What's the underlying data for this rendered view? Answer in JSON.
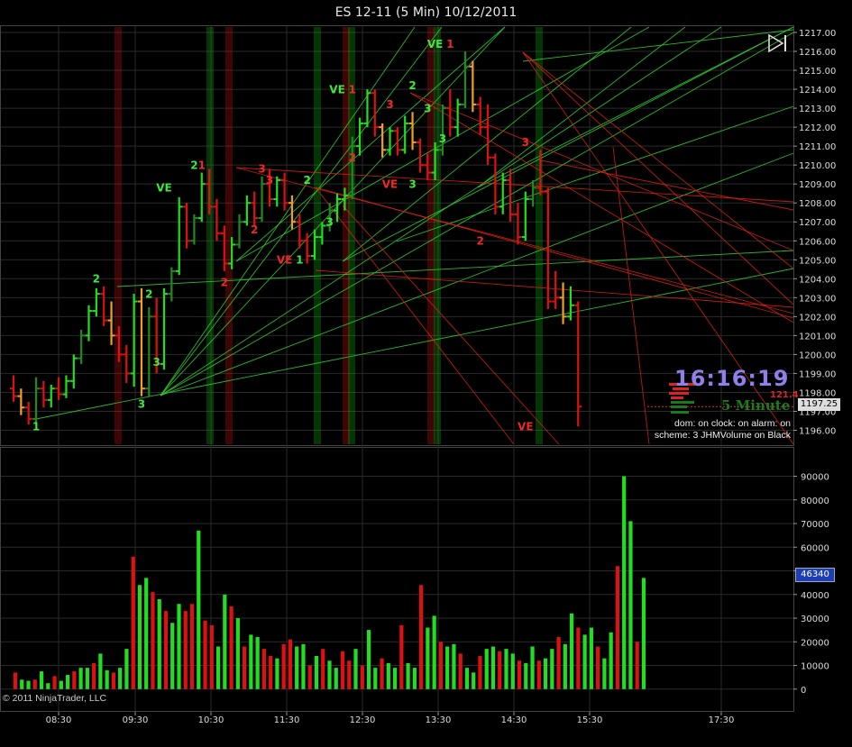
{
  "window": {
    "title": "ES 12-11 (5 Min)  10/12/2011"
  },
  "overlay": {
    "clock": "16:16:19",
    "timeframe": "5 Minute",
    "status_line": "dom: on clock: on alarm: on",
    "scheme_line": "scheme: 3 JHMVolume on Black",
    "small_value": "121.4"
  },
  "footer": {
    "copyright": "© 2011 NinjaTrader, LLC"
  },
  "colors": {
    "up": "#22dd22",
    "down": "#dd1111",
    "grid": "#2a2a2a",
    "dark_up": "#1f8a1f",
    "orange": "#f0a020"
  },
  "icons": {
    "play": "play-end-icon"
  },
  "chart_data": [
    {
      "type": "bar",
      "name": "price",
      "title": "ES 12-11 (5 Min) 10/12/2011",
      "ylim": [
        1195.5,
        1217
      ],
      "y_ticks": [
        "1196.00",
        "1197.00",
        "1198.00",
        "1199.00",
        "1200.00",
        "1201.00",
        "1202.00",
        "1203.00",
        "1204.00",
        "1205.00",
        "1206.00",
        "1207.00",
        "1208.00",
        "1209.00",
        "1210.00",
        "1211.00",
        "1212.00",
        "1213.00",
        "1214.00",
        "1215.00",
        "1216.00",
        "1217.00"
      ],
      "last_price": "1197.25",
      "bars": [
        {
          "o": 1198.2,
          "h": 1198.9,
          "l": 1197.5,
          "c": 1197.8,
          "u": 0
        },
        {
          "o": 1197.8,
          "h": 1198.2,
          "l": 1196.8,
          "c": 1197.2,
          "u": 0
        },
        {
          "o": 1197.2,
          "h": 1197.5,
          "l": 1196.3,
          "c": 1196.6,
          "u": 0
        },
        {
          "o": 1196.6,
          "h": 1198.8,
          "l": 1196.3,
          "c": 1198.2,
          "u": 1
        },
        {
          "o": 1198.2,
          "h": 1198.6,
          "l": 1197.2,
          "c": 1197.6,
          "u": 0
        },
        {
          "o": 1197.6,
          "h": 1198.4,
          "l": 1197.2,
          "c": 1198.2,
          "u": 1
        },
        {
          "o": 1198.2,
          "h": 1198.8,
          "l": 1197.6,
          "c": 1197.9,
          "u": 0
        },
        {
          "o": 1197.9,
          "h": 1198.9,
          "l": 1197.7,
          "c": 1198.6,
          "u": 1
        },
        {
          "o": 1198.6,
          "h": 1200.0,
          "l": 1198.2,
          "c": 1199.8,
          "u": 1
        },
        {
          "o": 1199.8,
          "h": 1201.3,
          "l": 1199.5,
          "c": 1201.0,
          "u": 1
        },
        {
          "o": 1201.0,
          "h": 1202.6,
          "l": 1200.7,
          "c": 1202.3,
          "u": 1
        },
        {
          "o": 1202.3,
          "h": 1203.5,
          "l": 1202.0,
          "c": 1203.2,
          "u": 1
        },
        {
          "o": 1203.2,
          "h": 1203.6,
          "l": 1201.5,
          "c": 1201.8,
          "u": 0
        },
        {
          "o": 1201.8,
          "h": 1202.8,
          "l": 1200.5,
          "c": 1201.0,
          "u": 0
        },
        {
          "o": 1201.0,
          "h": 1201.5,
          "l": 1199.6,
          "c": 1200.0,
          "u": 0
        },
        {
          "o": 1200.0,
          "h": 1200.5,
          "l": 1198.5,
          "c": 1199.0,
          "u": 0
        },
        {
          "o": 1199.0,
          "h": 1203.2,
          "l": 1198.3,
          "c": 1202.8,
          "u": 1
        },
        {
          "o": 1202.8,
          "h": 1203.5,
          "l": 1197.8,
          "c": 1198.2,
          "u": 0
        },
        {
          "o": 1198.2,
          "h": 1202.5,
          "l": 1197.8,
          "c": 1202.0,
          "u": 1
        },
        {
          "o": 1202.0,
          "h": 1203.0,
          "l": 1199.0,
          "c": 1199.5,
          "u": 0
        },
        {
          "o": 1199.5,
          "h": 1203.5,
          "l": 1199.2,
          "c": 1203.2,
          "u": 1
        },
        {
          "o": 1203.2,
          "h": 1204.6,
          "l": 1202.8,
          "c": 1204.4,
          "u": 1
        },
        {
          "o": 1204.4,
          "h": 1208.3,
          "l": 1204.2,
          "c": 1207.8,
          "u": 1
        },
        {
          "o": 1207.8,
          "h": 1208.0,
          "l": 1205.6,
          "c": 1206.0,
          "u": 0
        },
        {
          "o": 1206.0,
          "h": 1207.4,
          "l": 1205.8,
          "c": 1207.2,
          "u": 1
        },
        {
          "o": 1207.2,
          "h": 1209.6,
          "l": 1207.0,
          "c": 1209.0,
          "u": 1
        },
        {
          "o": 1209.0,
          "h": 1209.8,
          "l": 1207.4,
          "c": 1207.8,
          "u": 0
        },
        {
          "o": 1207.8,
          "h": 1208.2,
          "l": 1206.0,
          "c": 1206.4,
          "u": 0
        },
        {
          "o": 1206.4,
          "h": 1206.8,
          "l": 1204.4,
          "c": 1204.8,
          "u": 0
        },
        {
          "o": 1204.8,
          "h": 1206.2,
          "l": 1204.5,
          "c": 1205.8,
          "u": 1
        },
        {
          "o": 1205.8,
          "h": 1207.4,
          "l": 1205.6,
          "c": 1207.0,
          "u": 1
        },
        {
          "o": 1207.0,
          "h": 1208.4,
          "l": 1206.8,
          "c": 1208.0,
          "u": 1
        },
        {
          "o": 1208.0,
          "h": 1208.6,
          "l": 1206.8,
          "c": 1207.2,
          "u": 0
        },
        {
          "o": 1207.2,
          "h": 1209.4,
          "l": 1207.0,
          "c": 1209.0,
          "u": 1
        },
        {
          "o": 1209.0,
          "h": 1209.8,
          "l": 1207.8,
          "c": 1208.2,
          "u": 0
        },
        {
          "o": 1208.2,
          "h": 1209.4,
          "l": 1207.8,
          "c": 1209.2,
          "u": 1
        },
        {
          "o": 1209.2,
          "h": 1209.6,
          "l": 1207.6,
          "c": 1208.0,
          "u": 0
        },
        {
          "o": 1208.0,
          "h": 1208.4,
          "l": 1206.6,
          "c": 1207.0,
          "u": 0
        },
        {
          "o": 1207.0,
          "h": 1207.4,
          "l": 1205.6,
          "c": 1206.0,
          "u": 0
        },
        {
          "o": 1206.0,
          "h": 1206.4,
          "l": 1204.8,
          "c": 1205.2,
          "u": 0
        },
        {
          "o": 1205.2,
          "h": 1206.6,
          "l": 1205.0,
          "c": 1206.2,
          "u": 1
        },
        {
          "o": 1206.2,
          "h": 1207.0,
          "l": 1205.8,
          "c": 1206.8,
          "u": 1
        },
        {
          "o": 1206.8,
          "h": 1208.0,
          "l": 1206.5,
          "c": 1207.6,
          "u": 1
        },
        {
          "o": 1207.6,
          "h": 1208.5,
          "l": 1207.0,
          "c": 1208.2,
          "u": 1
        },
        {
          "o": 1208.2,
          "h": 1208.8,
          "l": 1207.6,
          "c": 1208.4,
          "u": 1
        },
        {
          "o": 1208.4,
          "h": 1211.5,
          "l": 1208.2,
          "c": 1211.0,
          "u": 1
        },
        {
          "o": 1211.0,
          "h": 1212.5,
          "l": 1210.5,
          "c": 1212.2,
          "u": 1
        },
        {
          "o": 1212.2,
          "h": 1214.0,
          "l": 1212.0,
          "c": 1213.8,
          "u": 1
        },
        {
          "o": 1213.8,
          "h": 1214.0,
          "l": 1211.5,
          "c": 1212.0,
          "u": 0
        },
        {
          "o": 1212.0,
          "h": 1212.2,
          "l": 1210.4,
          "c": 1210.8,
          "u": 0
        },
        {
          "o": 1210.8,
          "h": 1212.0,
          "l": 1210.5,
          "c": 1211.8,
          "u": 1
        },
        {
          "o": 1211.8,
          "h": 1212.0,
          "l": 1210.5,
          "c": 1210.8,
          "u": 0
        },
        {
          "o": 1210.8,
          "h": 1212.6,
          "l": 1210.6,
          "c": 1212.2,
          "u": 1
        },
        {
          "o": 1212.2,
          "h": 1212.8,
          "l": 1210.8,
          "c": 1211.2,
          "u": 0
        },
        {
          "o": 1211.2,
          "h": 1211.4,
          "l": 1209.6,
          "c": 1210.0,
          "u": 0
        },
        {
          "o": 1210.0,
          "h": 1210.6,
          "l": 1209.2,
          "c": 1209.6,
          "u": 0
        },
        {
          "o": 1209.6,
          "h": 1211.2,
          "l": 1209.2,
          "c": 1210.8,
          "u": 1
        },
        {
          "o": 1210.8,
          "h": 1213.2,
          "l": 1210.5,
          "c": 1213.0,
          "u": 1
        },
        {
          "o": 1213.0,
          "h": 1214.0,
          "l": 1211.5,
          "c": 1212.0,
          "u": 0
        },
        {
          "o": 1212.0,
          "h": 1213.5,
          "l": 1211.5,
          "c": 1213.2,
          "u": 1
        },
        {
          "o": 1213.2,
          "h": 1216.0,
          "l": 1213.0,
          "c": 1215.2,
          "u": 1
        },
        {
          "o": 1215.2,
          "h": 1215.5,
          "l": 1212.8,
          "c": 1213.2,
          "u": 0
        },
        {
          "o": 1213.2,
          "h": 1213.6,
          "l": 1211.6,
          "c": 1212.0,
          "u": 0
        },
        {
          "o": 1212.0,
          "h": 1213.2,
          "l": 1210.0,
          "c": 1210.4,
          "u": 0
        },
        {
          "o": 1210.4,
          "h": 1210.6,
          "l": 1207.4,
          "c": 1207.8,
          "u": 0
        },
        {
          "o": 1207.8,
          "h": 1209.6,
          "l": 1207.4,
          "c": 1209.2,
          "u": 1
        },
        {
          "o": 1209.2,
          "h": 1209.8,
          "l": 1207.0,
          "c": 1207.4,
          "u": 0
        },
        {
          "o": 1207.4,
          "h": 1208.0,
          "l": 1205.8,
          "c": 1206.2,
          "u": 0
        },
        {
          "o": 1206.2,
          "h": 1208.6,
          "l": 1206.0,
          "c": 1208.2,
          "u": 1
        },
        {
          "o": 1208.2,
          "h": 1209.2,
          "l": 1207.8,
          "c": 1208.8,
          "u": 1
        },
        {
          "o": 1208.8,
          "h": 1210.8,
          "l": 1208.4,
          "c": 1208.6,
          "u": 0
        },
        {
          "o": 1208.6,
          "h": 1208.8,
          "l": 1202.4,
          "c": 1202.8,
          "u": 0
        },
        {
          "o": 1202.8,
          "h": 1204.4,
          "l": 1202.4,
          "c": 1203.0,
          "u": 0
        },
        {
          "o": 1203.0,
          "h": 1203.8,
          "l": 1201.6,
          "c": 1202.0,
          "u": 0
        },
        {
          "o": 1202.0,
          "h": 1203.6,
          "l": 1201.8,
          "c": 1202.6,
          "u": 1
        },
        {
          "o": 1202.6,
          "h": 1202.8,
          "l": 1196.2,
          "c": 1197.25,
          "u": 0
        }
      ],
      "labels": [
        {
          "t": "1",
          "i": 3,
          "p": 1196.0,
          "c": "g"
        },
        {
          "t": "2",
          "i": 11,
          "p": 1203.8,
          "c": "g"
        },
        {
          "t": "3",
          "i": 17,
          "p": 1197.2,
          "c": "g"
        },
        {
          "t": "3",
          "i": 19,
          "p": 1199.4,
          "c": "g"
        },
        {
          "t": "2",
          "i": 18,
          "p": 1203.0,
          "c": "g"
        },
        {
          "t": "VE",
          "i": 20,
          "p": 1208.6,
          "c": "g"
        },
        {
          "t": "2",
          "i": 24,
          "p": 1209.8,
          "c": "g"
        },
        {
          "t": "1",
          "i": 25,
          "p": 1209.8,
          "c": "r"
        },
        {
          "t": "2",
          "i": 28,
          "p": 1203.6,
          "c": "r"
        },
        {
          "t": "3",
          "i": 33,
          "p": 1209.6,
          "c": "r"
        },
        {
          "t": "3",
          "i": 34,
          "p": 1209.0,
          "c": "r"
        },
        {
          "t": "2",
          "i": 32,
          "p": 1206.4,
          "c": "r"
        },
        {
          "t": "VE",
          "i": 36,
          "p": 1204.8,
          "c": "r"
        },
        {
          "t": "1",
          "i": 38,
          "p": 1204.8,
          "c": "g"
        },
        {
          "t": "2",
          "i": 39,
          "p": 1209.0,
          "c": "g"
        },
        {
          "t": "3",
          "i": 42,
          "p": 1206.8,
          "c": "g"
        },
        {
          "t": "VE",
          "i": 43,
          "p": 1213.8,
          "c": "g"
        },
        {
          "t": "1",
          "i": 45,
          "p": 1213.8,
          "c": "r"
        },
        {
          "t": "3",
          "i": 50,
          "p": 1213.0,
          "c": "r"
        },
        {
          "t": "2",
          "i": 45,
          "p": 1210.2,
          "c": "r"
        },
        {
          "t": "VE",
          "i": 50,
          "p": 1208.8,
          "c": "r"
        },
        {
          "t": "3",
          "i": 53,
          "p": 1208.8,
          "c": "g"
        },
        {
          "t": "2",
          "i": 53,
          "p": 1214.0,
          "c": "g"
        },
        {
          "t": "3",
          "i": 55,
          "p": 1212.8,
          "c": "g"
        },
        {
          "t": "3",
          "i": 57,
          "p": 1211.2,
          "c": "g"
        },
        {
          "t": "VE",
          "i": 56,
          "p": 1216.2,
          "c": "g"
        },
        {
          "t": "1",
          "i": 58,
          "p": 1216.2,
          "c": "r"
        },
        {
          "t": "3",
          "i": 68,
          "p": 1211.0,
          "c": "r"
        },
        {
          "t": "2",
          "i": 62,
          "p": 1205.8,
          "c": "r"
        },
        {
          "t": "VE",
          "i": 68,
          "p": 1196.0,
          "c": "r"
        }
      ]
    },
    {
      "type": "bar",
      "name": "volume",
      "ylim": [
        -2000,
        94000
      ],
      "y_ticks": [
        "0",
        "10000",
        "20000",
        "30000",
        "40000",
        "50000",
        "60000",
        "70000",
        "80000",
        "90000"
      ],
      "last_value": "46340",
      "values": [
        7000,
        4000,
        3500,
        4000,
        7500,
        2500,
        5500,
        3500,
        6000,
        7500,
        9000,
        9000,
        11000,
        15000,
        8000,
        7000,
        9000,
        17000,
        56000,
        44000,
        47000,
        41000,
        38000,
        33000,
        28000,
        36000,
        33000,
        36000,
        67000,
        29000,
        27000,
        18000,
        40000,
        35000,
        30000,
        18000,
        23000,
        22000,
        17000,
        14000,
        13000,
        19000,
        21000,
        18000,
        19000,
        10000,
        14000,
        17000,
        12000,
        9000,
        16000,
        12000,
        17000,
        10000,
        25000,
        9000,
        13000,
        11000,
        9000,
        27000,
        11000,
        9000,
        44000,
        26000,
        31000,
        20000,
        18000,
        19000,
        15000,
        9000,
        7000,
        14000,
        17000,
        18000,
        16000,
        17000,
        15000,
        12000,
        11000,
        18000,
        12000,
        13000,
        17000,
        22000,
        19000,
        32000,
        26000,
        23000,
        26000,
        18000,
        13000,
        24000,
        52000,
        90000,
        71000,
        20000,
        47000
      ],
      "x_ticks": [
        "08:30",
        "09:30",
        "10:30",
        "11:30",
        "12:30",
        "13:30",
        "14:30",
        "15:30",
        "17:30"
      ]
    }
  ]
}
